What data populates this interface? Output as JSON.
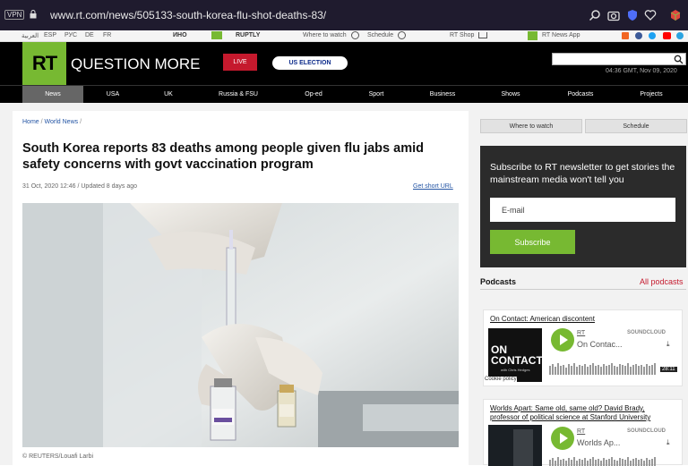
{
  "browser": {
    "vpn": "VPN",
    "url": "www.rt.com/news/505133-south-korea-flu-shot-deaths-83/"
  },
  "strip": {
    "languages": [
      "العربية",
      "ESP",
      "РУС",
      "DE",
      "FR"
    ],
    "partners": [
      "ИНО",
      "RUPTLY"
    ],
    "where_to_watch": "Where to watch",
    "schedule": "Schedule",
    "shop": "RT Shop",
    "app": "RT News App"
  },
  "header": {
    "logo": "RT",
    "tagline": "QUESTION MORE",
    "live": "LIVE",
    "us_election": "US ELECTION",
    "datetime": "04:36 GMT, Nov 09, 2020"
  },
  "nav": [
    "News",
    "USA",
    "UK",
    "Russia & FSU",
    "Op-ed",
    "Sport",
    "Business",
    "Shows",
    "Podcasts",
    "Projects"
  ],
  "article": {
    "breadcrumb": [
      "Home",
      "World News"
    ],
    "title": "South Korea reports 83 deaths among people given flu jabs amid safety concerns with govt vaccination program",
    "date": "31 Oct, 2020 12:46 / Updated 8 days ago",
    "short_url": "Get short URL",
    "credit": "© REUTERS/Louafi Larbi"
  },
  "sidebar": {
    "where_to_watch": "Where to watch",
    "schedule": "Schedule",
    "newsletter_text": "Subscribe to RT newsletter to get stories the mainstream media won't tell you",
    "email_placeholder": "E-mail",
    "subscribe": "Subscribe",
    "podcasts_heading": "Podcasts",
    "all_podcasts": "All podcasts",
    "podcasts": [
      {
        "title": "On Contact: American discontent",
        "author": "RT",
        "name": "On Contac...",
        "duration": "28:11",
        "thumb_text": "ON CONTACT",
        "thumb_sub": "with Chris Hedges",
        "cookie": "Cookie policy"
      },
      {
        "title": "Worlds Apart: Same old, same old? David Brady, professor of political science at Stanford University",
        "author": "RT",
        "name": "Worlds Ap..."
      }
    ],
    "soundcloud": "SOUNDCLOUD"
  }
}
